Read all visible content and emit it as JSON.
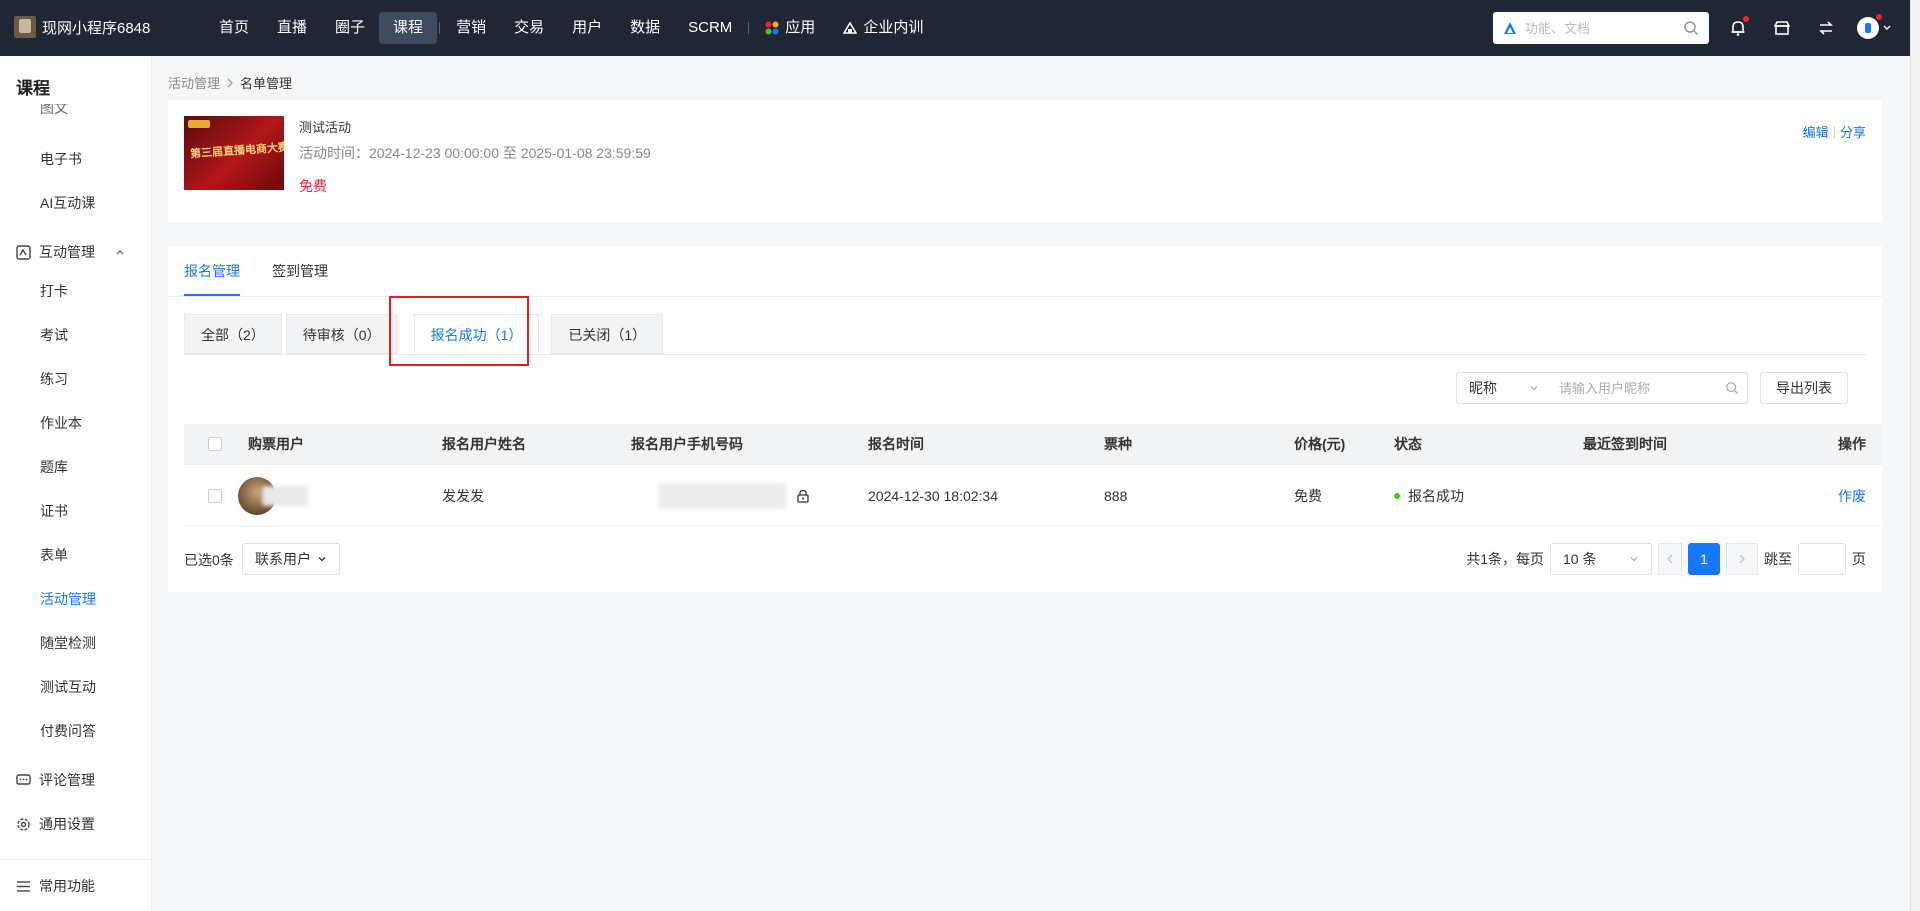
{
  "app": {
    "name": "现网小程序6848"
  },
  "nav": {
    "items": [
      "首页",
      "直播",
      "圈子",
      "课程",
      "营销",
      "交易",
      "用户",
      "数据",
      "SCRM",
      "应用",
      "企业内训"
    ],
    "active": "课程"
  },
  "search": {
    "placeholder": "功能、文档"
  },
  "sidebar": {
    "title": "课程",
    "partial_item": "图文",
    "items_top": [
      "电子书",
      "AI互动课"
    ],
    "group_interact": "互动管理",
    "items_interact": [
      "打卡",
      "考试",
      "练习",
      "作业本",
      "题库",
      "证书",
      "表单",
      "活动管理",
      "随堂检测",
      "测试互动",
      "付费问答"
    ],
    "active": "活动管理",
    "group_comment": "评论管理",
    "group_settings": "通用设置",
    "common": "常用功能"
  },
  "breadcrumb": {
    "parent": "活动管理",
    "current": "名单管理"
  },
  "activity": {
    "title": "测试活动",
    "time": "活动时间：2024-12-23 00:00:00 至 2025-01-08 23:59:59",
    "price": "免费",
    "edit": "编辑",
    "share": "分享",
    "poster_text": "第三届直播电商大赛"
  },
  "tabs": {
    "main": [
      "报名管理",
      "签到管理"
    ],
    "sub": [
      "全部（2）",
      "待审核（0）",
      "报名成功（1）",
      "已关闭（1）"
    ]
  },
  "filter": {
    "select": "昵称",
    "placeholder": "请输入用户昵称",
    "export": "导出列表"
  },
  "table": {
    "headers": [
      "购票用户",
      "报名用户姓名",
      "报名用户手机号码",
      "报名时间",
      "票种",
      "价格(元)",
      "状态",
      "最近签到时间",
      "操作"
    ],
    "rows": [
      {
        "name": "发发发",
        "time": "2024-12-30 18:02:34",
        "ticket": "888",
        "price": "免费",
        "status": "报名成功",
        "action": "作废"
      }
    ]
  },
  "footer": {
    "selected": "已选0条",
    "contact": "联系用户",
    "total": "共1条，每页",
    "page_size": "10 条",
    "current_page": "1",
    "jump": "跳至",
    "page_suffix": "页"
  },
  "colors": {
    "accent": "#1677ff",
    "topbar": "#1f2634",
    "danger": "#f5222d",
    "success": "#52c41a",
    "highlight": "#e51c23"
  }
}
